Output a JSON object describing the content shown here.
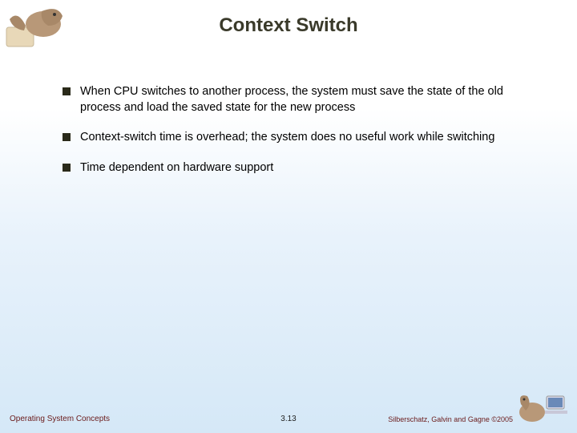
{
  "title": "Context Switch",
  "bullets": [
    "When CPU switches to another process, the system must save the state of the old process and load the saved state for the new process",
    "Context-switch time is overhead; the system does no useful work while switching",
    "Time dependent on hardware support"
  ],
  "footer": {
    "left": "Operating System Concepts",
    "center": "3.13",
    "right": "Silberschatz, Galvin and Gagne ©2005"
  }
}
